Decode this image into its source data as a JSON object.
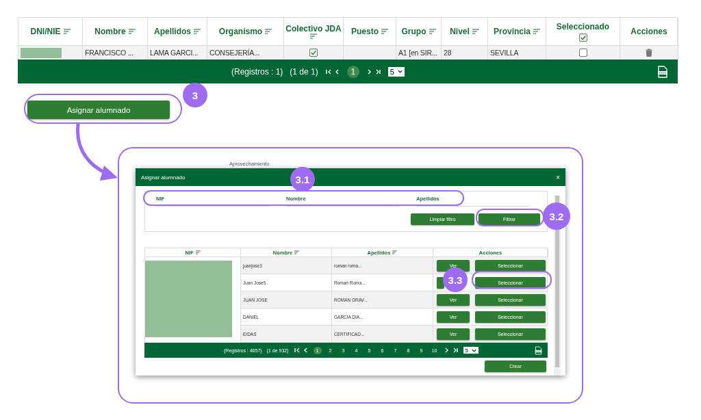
{
  "top_table": {
    "columns": [
      {
        "label": "DNI/NIE",
        "kind": "sort"
      },
      {
        "label": "Nombre",
        "kind": "sort"
      },
      {
        "label": "Apellidos",
        "kind": "sort"
      },
      {
        "label": "Organismo",
        "kind": "sort"
      },
      {
        "label": "Colectivo JDA",
        "kind": "sort_below"
      },
      {
        "label": "Puesto",
        "kind": "sort"
      },
      {
        "label": "Grupo",
        "kind": "sort"
      },
      {
        "label": "Nivel",
        "kind": "sort"
      },
      {
        "label": "Provincia",
        "kind": "sort"
      },
      {
        "label": "Seleccionado",
        "kind": "check",
        "checked": true
      },
      {
        "label": "Acciones",
        "kind": "plain"
      }
    ],
    "rows": [
      {
        "cells": [
          {
            "kind": "redacted"
          },
          {
            "kind": "text",
            "text": "FRANCISCO ..."
          },
          {
            "kind": "text",
            "text": "LAMA GARCI..."
          },
          {
            "kind": "text",
            "text": "CONSEJERÍA..."
          },
          {
            "kind": "check",
            "checked": true
          },
          {
            "kind": "empty"
          },
          {
            "kind": "text",
            "text": "A1 [en SIR..."
          },
          {
            "kind": "text",
            "text": "28"
          },
          {
            "kind": "text",
            "text": "SEVILLA"
          },
          {
            "kind": "check",
            "checked": false
          },
          {
            "kind": "trash"
          }
        ]
      }
    ],
    "footer": {
      "records": "(Registros : 1)",
      "page_info": "(1 de 1)",
      "pages": [
        {
          "label": "1",
          "selected": true
        }
      ],
      "page_size": "5"
    }
  },
  "assign_button": "Asignar alumnado",
  "dialog": {
    "background_text": "Aprovechamiento",
    "title": "Asignar alumnado",
    "close": "×",
    "filters": [
      {
        "label": "NIF"
      },
      {
        "label": "Nombre"
      },
      {
        "label": "Apellidos"
      }
    ],
    "buttons": [
      "Limpiar filtro",
      "Filtrar"
    ],
    "columns": [
      {
        "label": "NIF",
        "kind": "sort"
      },
      {
        "label": "Nombre",
        "kind": "sort"
      },
      {
        "label": "Apellidos",
        "kind": "sort"
      },
      {
        "label": "Acciones",
        "kind": "plain"
      }
    ],
    "rows": [
      {
        "nombre": "juanjose3",
        "apellidos": "roman roma...",
        "view": "Ver",
        "select": "Seleccionar"
      },
      {
        "nombre": "Juan Jose5",
        "apellidos": "Roman Roma...",
        "select": "Seleccionar"
      },
      {
        "nombre": "JUAN JOSE",
        "apellidos": "ROMAN GRAV...",
        "view": "Ver",
        "select": "Seleccionar"
      },
      {
        "nombre": "DANIEL",
        "apellidos": "GARCIA DIA...",
        "view": "Ver",
        "select": "Seleccionar"
      },
      {
        "nombre": "EIDAS",
        "apellidos": "CERTIFICAD...",
        "view": "Ver",
        "select": "Seleccionar"
      }
    ],
    "footer": {
      "records": "(Registros : 4657)",
      "page_info": "(1 de 932)",
      "pages": [
        {
          "label": "1",
          "selected": true
        },
        {
          "label": "2",
          "selected": false
        },
        {
          "label": "3",
          "selected": false
        },
        {
          "label": "4",
          "selected": false
        },
        {
          "label": "5",
          "selected": false
        },
        {
          "label": "6",
          "selected": false
        },
        {
          "label": "7",
          "selected": false
        },
        {
          "label": "8",
          "selected": false
        },
        {
          "label": "9",
          "selected": false
        },
        {
          "label": "10",
          "selected": false
        }
      ],
      "page_size": "5"
    },
    "create_button": "Crear"
  },
  "annotations": [
    {
      "label": "3"
    },
    {
      "label": "3.1"
    },
    {
      "label": "3.2"
    },
    {
      "label": "3.3"
    }
  ]
}
